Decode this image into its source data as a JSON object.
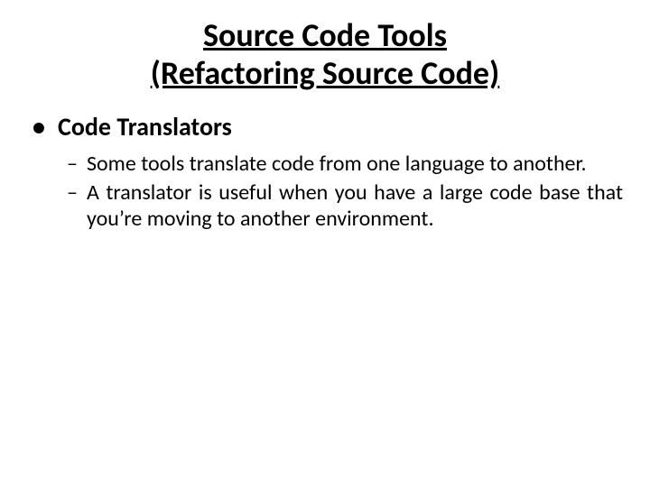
{
  "title_line1": "Source Code Tools",
  "title_line2": "(Refactoring Source Code)",
  "l1_marker": "•",
  "l1_text": "Code Translators",
  "l2_marker": "–",
  "sub1": "Some tools translate code from one language to another.",
  "sub2": "A translator is useful when you have a large code base that you’re moving to another environment."
}
